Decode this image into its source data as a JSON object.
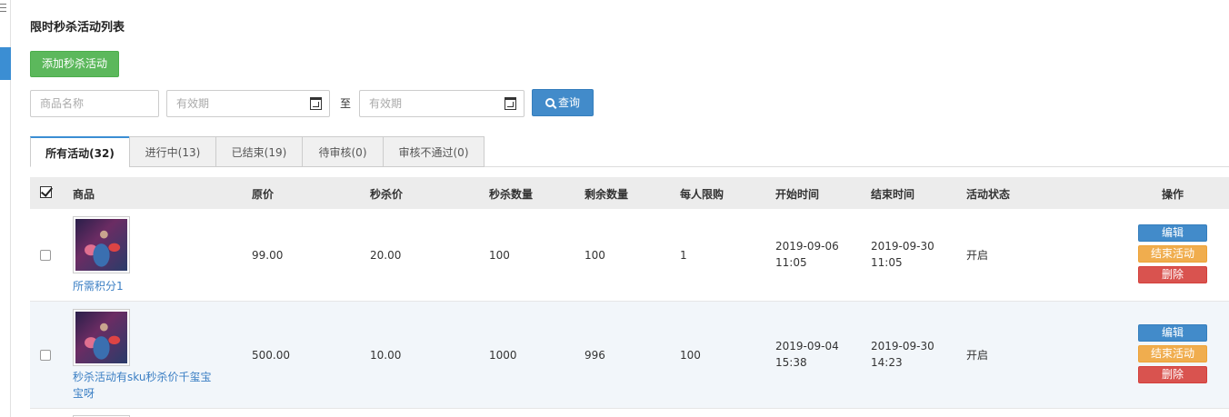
{
  "page": {
    "title": "限时秒杀活动列表"
  },
  "toolbar": {
    "add_label": "添加秒杀活动"
  },
  "filters": {
    "name_placeholder": "商品名称",
    "start_placeholder": "有效期",
    "to_label": "至",
    "end_placeholder": "有效期",
    "search_label": "查询"
  },
  "tabs": [
    {
      "label": "所有活动(32)",
      "active": true
    },
    {
      "label": "进行中(13)"
    },
    {
      "label": "已结束(19)"
    },
    {
      "label": "待审核(0)"
    },
    {
      "label": "审核不通过(0)"
    }
  ],
  "table": {
    "columns": [
      "商品",
      "原价",
      "秒杀价",
      "秒杀数量",
      "剩余数量",
      "每人限购",
      "开始时间",
      "结束时间",
      "活动状态",
      "操作"
    ],
    "rows": [
      {
        "name": "所需积分1",
        "original_price": "99.00",
        "seckill_price": "20.00",
        "seckill_qty": "100",
        "remaining_qty": "100",
        "limit_per_user": "1",
        "start_date": "2019-09-06",
        "start_time": "11:05",
        "end_date": "2019-09-30",
        "end_time": "11:05",
        "status": "开启"
      },
      {
        "name_line1": "秒杀活动有sku秒杀价千玺宝",
        "name_line2": "宝呀",
        "original_price": "500.00",
        "seckill_price": "10.00",
        "seckill_qty": "1000",
        "remaining_qty": "996",
        "limit_per_user": "100",
        "start_date": "2019-09-04",
        "start_time": "15:38",
        "end_date": "2019-09-30",
        "end_time": "14:23",
        "status": "开启"
      }
    ],
    "actions": {
      "edit": "编辑",
      "end": "结束活动",
      "delete": "删除"
    }
  },
  "colors": {
    "primary": "#428bca",
    "success": "#5cb85c",
    "warning": "#f0ad4e",
    "danger": "#d9534f",
    "link": "#3b7fc4"
  }
}
